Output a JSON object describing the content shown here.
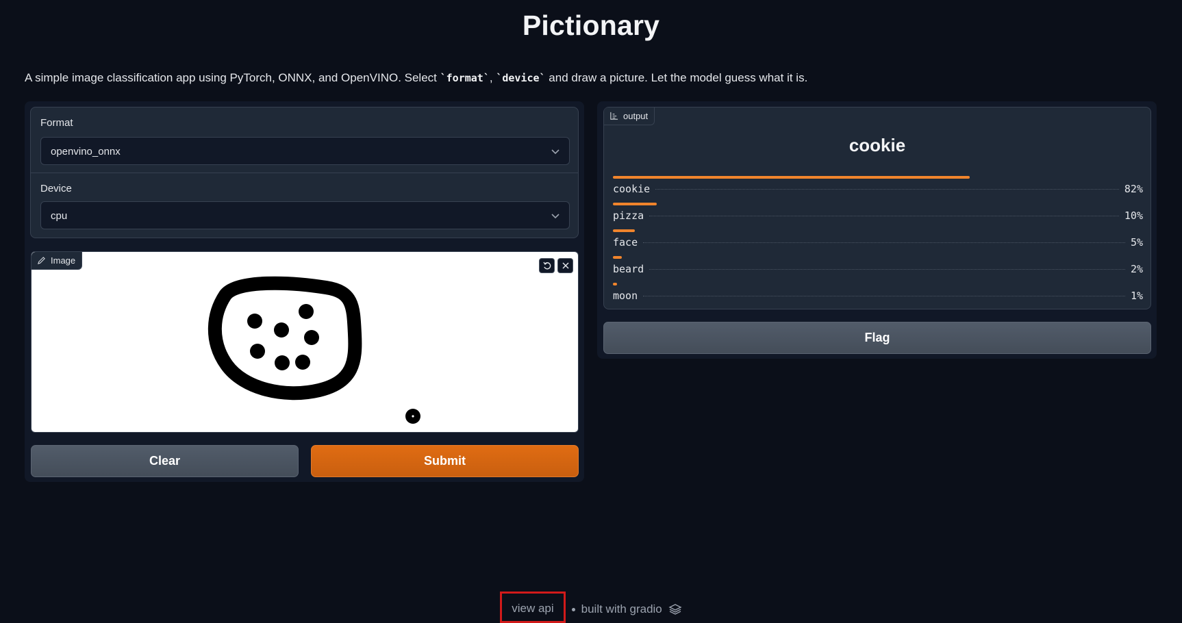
{
  "app": {
    "title": "Pictionary",
    "description_pre": "A simple image classification app using PyTorch, ONNX, and OpenVINO. Select ",
    "code_format": "`format`",
    "description_comma": ", ",
    "code_device": "`device`",
    "description_post": " and draw a picture. Let the model guess what it is."
  },
  "inputs": {
    "format": {
      "label": "Format",
      "value": "openvino_onnx"
    },
    "device": {
      "label": "Device",
      "value": "cpu"
    },
    "image": {
      "label": "Image",
      "undo_icon": "undo-icon",
      "clear_icon": "close-icon"
    }
  },
  "buttons": {
    "clear": "Clear",
    "submit": "Submit",
    "flag": "Flag"
  },
  "output": {
    "label": "output",
    "top_label": "cookie",
    "confidences": [
      {
        "label": "cookie",
        "value": 0.82,
        "display": "82%"
      },
      {
        "label": "pizza",
        "value": 0.1,
        "display": "10%"
      },
      {
        "label": "face",
        "value": 0.05,
        "display": "5%"
      },
      {
        "label": "beard",
        "value": 0.02,
        "display": "2%"
      },
      {
        "label": "moon",
        "value": 0.01,
        "display": "1%"
      }
    ]
  },
  "footer": {
    "view_api": "view api",
    "built_with": "built with gradio"
  },
  "colors": {
    "background": "#0b0f19",
    "panel": "#1f2937",
    "accent": "#f0842c",
    "submit": "#d2640f",
    "highlight_box": "#d11a1a"
  }
}
